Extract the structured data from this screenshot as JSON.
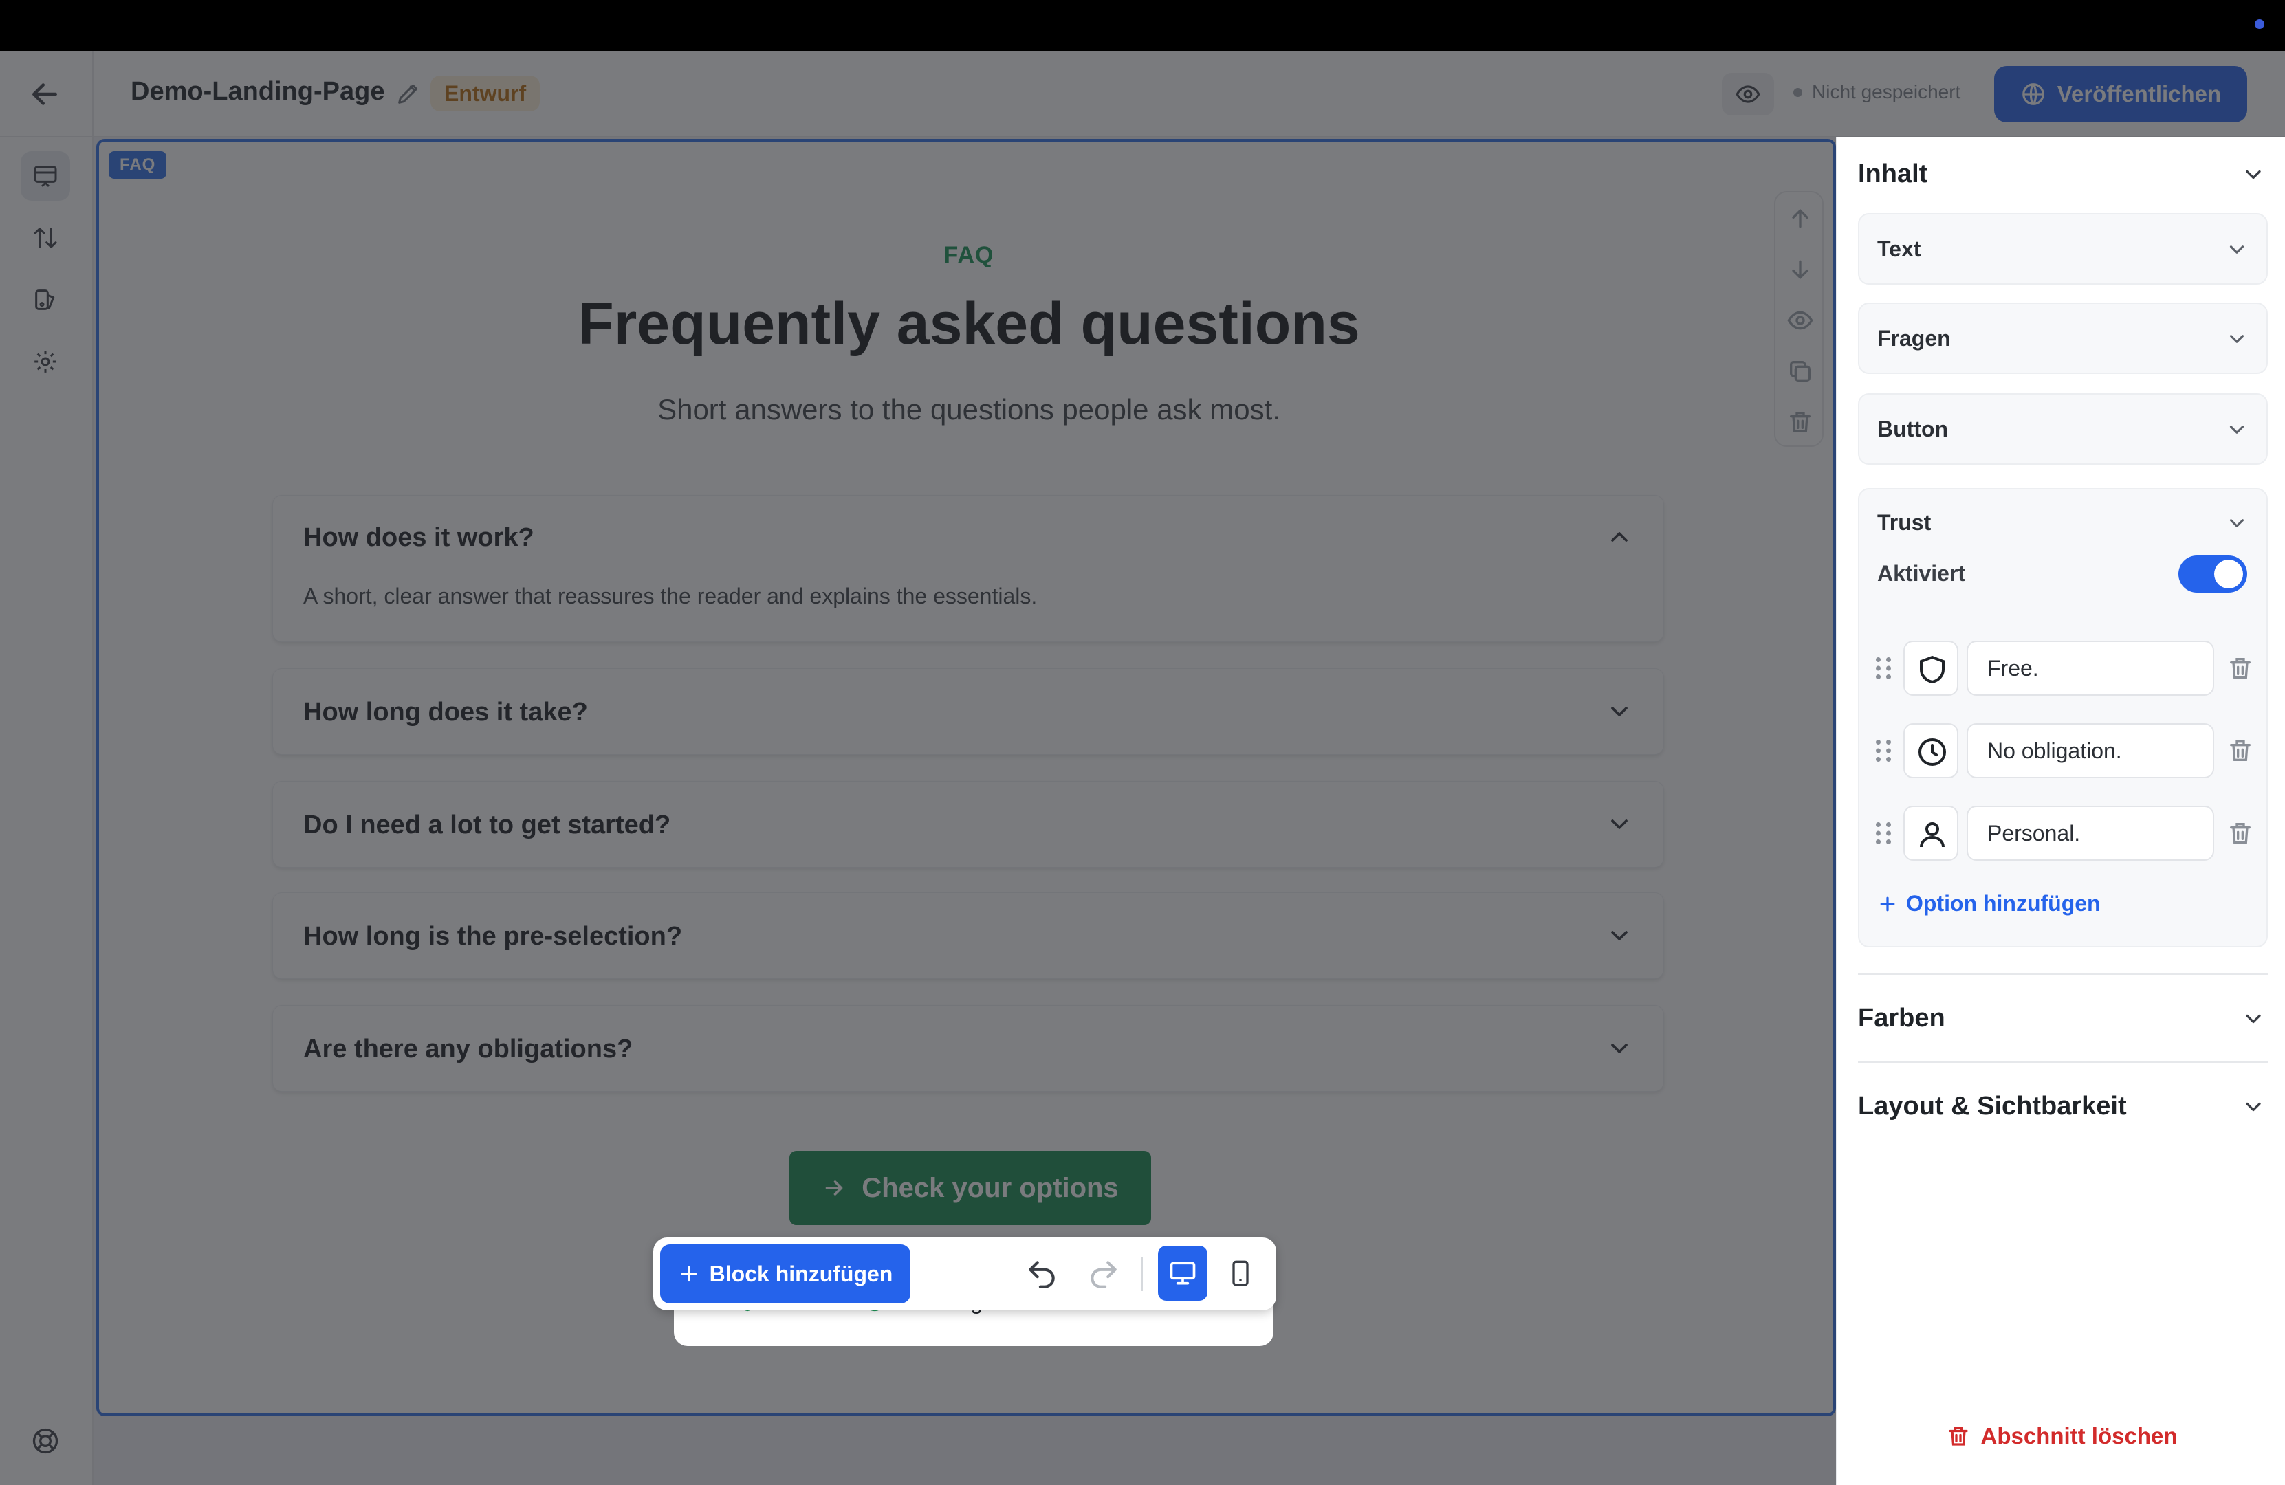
{
  "header": {
    "page_title": "Demo-Landing-Page",
    "draft_badge": "Entwurf",
    "save_state": "Nicht gespeichert",
    "publish_label": "Veröffentlichen"
  },
  "section": {
    "tag": "FAQ",
    "eyebrow": "FAQ",
    "title": "Frequently asked questions",
    "subtitle": "Short answers to the questions people ask most.",
    "faqs": [
      {
        "question": "How does it work?",
        "answer": "A short, clear answer that reassures the reader and explains the essentials.",
        "expanded": true
      },
      {
        "question": "How long does it take?",
        "expanded": false
      },
      {
        "question": "Do I need a lot to get started?",
        "expanded": false
      },
      {
        "question": "How long is the pre-selection?",
        "expanded": false
      },
      {
        "question": "Are there any obligations?",
        "expanded": false
      }
    ],
    "cta_label": "Check your options",
    "trust_items": [
      {
        "label": "Free.",
        "icon": "shield-icon"
      },
      {
        "label": "No obligation.",
        "icon": "clock-icon"
      },
      {
        "label": "Personal.",
        "icon": "user-icon"
      }
    ]
  },
  "toolbar": {
    "add_block_label": "Block hinzufügen"
  },
  "panel": {
    "heading": "Inhalt",
    "groups": [
      "Text",
      "Fragen",
      "Button"
    ],
    "trust": {
      "label": "Trust",
      "activated_label": "Aktiviert",
      "activated": true,
      "options": [
        "Free.",
        "No obligation.",
        "Personal."
      ],
      "add_option_label": "Option hinzufügen"
    },
    "colors_label": "Farben",
    "layout_label": "Layout & Sichtbarkeit",
    "delete_label": "Abschnitt löschen"
  },
  "colors": {
    "accent": "#2563eb",
    "cta_green": "#138a4c",
    "draft_orange": "#b66b0c",
    "danger": "#d22b2b"
  }
}
